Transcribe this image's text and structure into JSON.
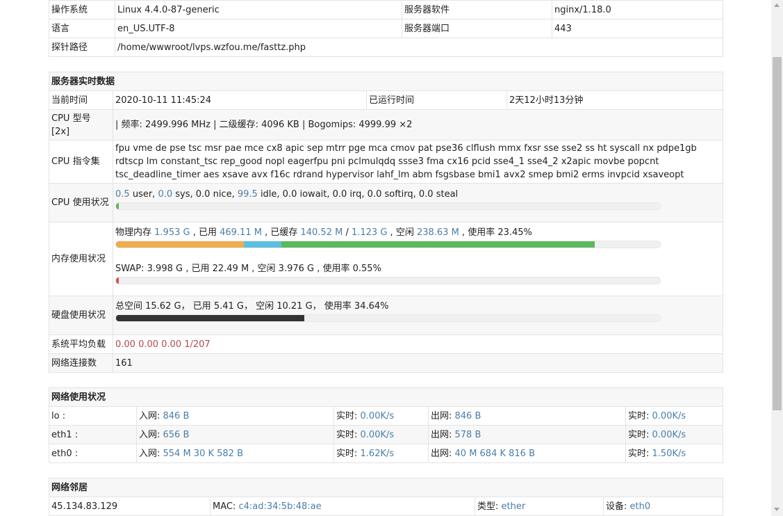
{
  "sysinfo": {
    "os_label": "操作系统",
    "os_value": "Linux 4.4.0-87-generic",
    "server_sw_label": "服务器软件",
    "server_sw_value": "nginx/1.18.0",
    "lang_label": "语言",
    "lang_value": "en_US.UTF-8",
    "port_label": "服务器端口",
    "port_value": "443",
    "path_label": "探针路径",
    "path_value": "/home/wwwroot/lvps.wzfou.me/fasttz.php"
  },
  "realtime": {
    "title": "服务器实时数据",
    "time_label": "当前时间",
    "time_value": "2020-10-11 11:45:24",
    "uptime_label": "已运行时间",
    "uptime_value": "2天12小时13分钟",
    "cpu_model_label": "CPU 型号 [2x]",
    "cpu_model_value": "| 频率: 2499.996 MHz | 二级缓存: 4096 KB | Bogomips: 4999.99 ×2",
    "cpu_flags_label": "CPU 指令集",
    "cpu_flags_value": "fpu vme de pse tsc msr pae mce cx8 apic sep mtrr pge mca cmov pat pse36 clflush mmx fxsr sse sse2 ss ht syscall nx pdpe1gb rdtscp lm constant_tsc rep_good nopl eagerfpu pni pclmulqdq ssse3 fma cx16 pcid sse4_1 sse4_2 x2apic movbe popcnt tsc_deadline_timer aes xsave avx f16c rdrand hypervisor lahf_lm abm fsgsbase bmi1 avx2 smep bmi2 erms invpcid xsaveopt",
    "cpu_usage_label": "CPU 使用状况",
    "cpu": {
      "user": "0.5",
      "user_suffix": " user, ",
      "sys": "0.0",
      "sys_suffix": " sys, 0.0 nice, ",
      "idle": "99.5",
      "idle_suffix": " idle, 0.0 iowait, 0.0 irq, 0.0 softirq, 0.0 steal",
      "bar_percent": 0.5,
      "bar_color": "#5cb85c"
    },
    "mem_label": "内存使用状况",
    "mem": {
      "p_prefix": "物理内存 ",
      "total": "1.953 G",
      "used_prefix": " , 已用 ",
      "used": "469.11 M",
      "cached_prefix": " , 已缓存 ",
      "cached": "140.52 M",
      "slash": " / ",
      "cached2": "1.123 G",
      "free_prefix": " , 空闲 ",
      "free": "238.63 M",
      "rate_text": " , 使用率 23.45%",
      "bar_used_percent": 23.45,
      "bar_cached_percent": 7.0,
      "bar_buffer_percent": 57.5,
      "used_color": "#f0ad4e",
      "cached_color": "#5bc0de",
      "buffer_color": "#5cb85c"
    },
    "swap": {
      "text": "SWAP: 3.998 G , 已用 22.49 M , 空闲 3.976 G , 使用率 0.55%",
      "bar_percent": 0.55,
      "bar_color": "#d9534f"
    },
    "disk_label": "硬盘使用状况",
    "disk": {
      "text": "总空间 15.62 G， 已用 5.41 G， 空闲 10.21 G， 使用率 34.64%",
      "bar_percent": 34.64,
      "bar_color": "#333333"
    },
    "load_label": "系统平均负载",
    "load_value": "0.00 0.00 0.00 1/207",
    "conn_label": "网络连接数",
    "conn_value": "161"
  },
  "network": {
    "title": "网络使用状况",
    "in_label": "入网: ",
    "out_label": "出网: ",
    "rt_label": "实时: ",
    "rows": [
      {
        "name": "lo :",
        "in": "846 B",
        "in_rt": "0.00K/s",
        "out": "846 B",
        "out_rt": "0.00K/s"
      },
      {
        "name": "eth1 :",
        "in": "656 B",
        "in_rt": "0.00K/s",
        "out": "578 B",
        "out_rt": "0.00K/s"
      },
      {
        "name": "eth0 :",
        "in": "554 M 30 K 582 B",
        "in_rt": "1.62K/s",
        "out": "40 M 684 K 816 B",
        "out_rt": "1.50K/s"
      }
    ]
  },
  "neighbors": {
    "title": "网络邻居",
    "rows": [
      {
        "ip": "45.134.83.129",
        "mac_label": "MAC: ",
        "mac": "c4:ad:34:5b:48:ae",
        "type_label": "类型: ",
        "type": "ether",
        "dev_label": "设备: ",
        "dev": "eth0"
      }
    ]
  }
}
